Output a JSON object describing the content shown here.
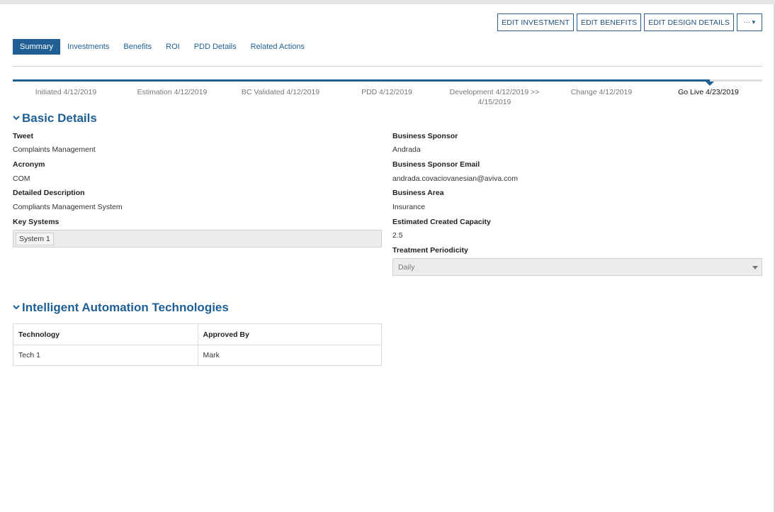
{
  "toolbar": {
    "edit_investment": "EDIT INVESTMENT",
    "edit_benefits": "EDIT BENEFITS",
    "edit_design_details": "EDIT DESIGN DETAILS",
    "more": "··· ▾"
  },
  "tabs": [
    {
      "label": "Summary",
      "active": true
    },
    {
      "label": "Investments"
    },
    {
      "label": "Benefits"
    },
    {
      "label": "ROI"
    },
    {
      "label": "PDD Details"
    },
    {
      "label": "Related Actions"
    }
  ],
  "progress": {
    "fill_fraction": 0.93,
    "stages": [
      {
        "label": "Initiated 4/12/2019"
      },
      {
        "label": "Estimation 4/12/2019"
      },
      {
        "label": "BC Validated 4/12/2019"
      },
      {
        "label": "PDD 4/12/2019"
      },
      {
        "label": "Development 4/12/2019 >> 4/15/2019"
      },
      {
        "label": "Change 4/12/2019"
      },
      {
        "label": "Go Live 4/23/2019",
        "current": true
      }
    ]
  },
  "basic_details": {
    "title": "Basic Details",
    "tweet_label": "Tweet",
    "tweet_value": "Complaints Management",
    "acronym_label": "Acronym",
    "acronym_value": "COM",
    "description_label": "Detailed Description",
    "description_value": "Compliants Management System",
    "key_systems_label": "Key Systems",
    "key_systems": [
      "System 1"
    ],
    "sponsor_label": "Business Sponsor",
    "sponsor_value": "Andrada",
    "sponsor_email_label": "Business Sponsor Email",
    "sponsor_email_value": "andrada.covaciovanesian@aviva.com",
    "area_label": "Business Area",
    "area_value": "Insurance",
    "capacity_label": "Estimated Created Capacity",
    "capacity_value": "2.5",
    "periodicity_label": "Treatment Periodicity",
    "periodicity_value": "Daily"
  },
  "automation": {
    "title": "Intelligent Automation Technologies",
    "columns": [
      "Technology",
      "Approved By"
    ],
    "rows": [
      [
        "Tech 1",
        "Mark"
      ]
    ]
  },
  "colors": {
    "accent": "#1f5f94",
    "border": "#2b5f8c"
  }
}
